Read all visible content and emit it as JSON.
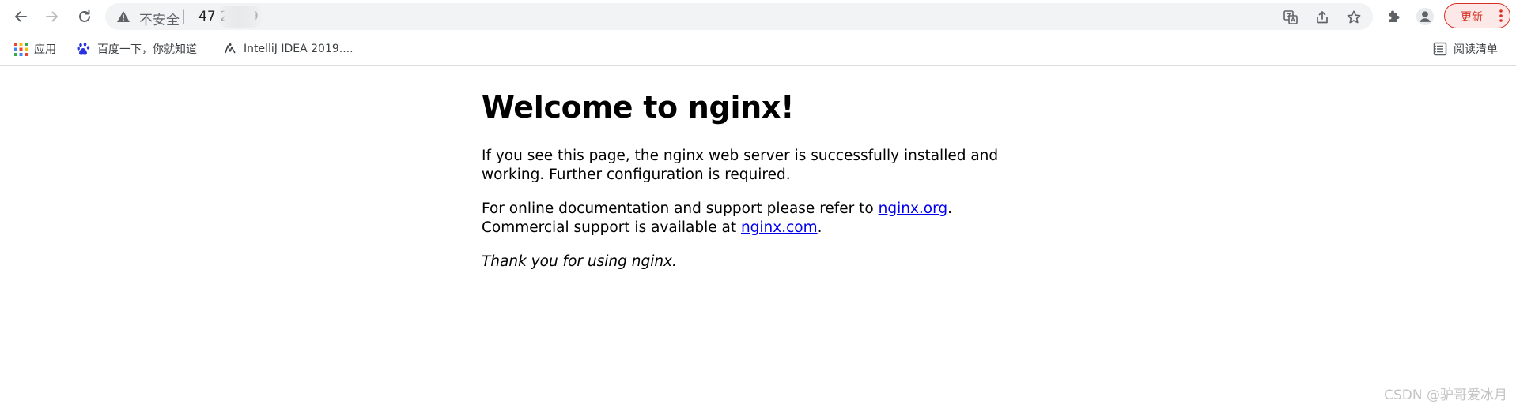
{
  "browser": {
    "omnibox": {
      "security_label": "不安全",
      "separator": "|",
      "url": "47                2.129"
    },
    "update_button": "更新",
    "reading_list": "阅读清单",
    "bookmarks": [
      {
        "label": "应用",
        "icon": "apps-grid-icon"
      },
      {
        "label": "百度一下，你就知道",
        "icon": "baidu-paw-icon"
      },
      {
        "label": "IntelliJ IDEA 2019....",
        "icon": "intellij-icon"
      }
    ]
  },
  "page": {
    "title": "Welcome to nginx!",
    "para1_line1": "If you see this page, the nginx web server is successfully installed and",
    "para1_line2": "working. Further configuration is required.",
    "para2_prefix": "For online documentation and support please refer to ",
    "link_org": "nginx.org",
    "para2_suffix1": ".",
    "para2_line2_prefix": "Commercial support is available at ",
    "link_com": "nginx.com",
    "para2_suffix2": ".",
    "thanks": "Thank you for using nginx."
  },
  "watermark": "CSDN @驴哥爱冰月",
  "colors": {
    "update_accent": "#d93025",
    "link": "#0000ee",
    "omnibox_bg": "#f1f3f4"
  }
}
